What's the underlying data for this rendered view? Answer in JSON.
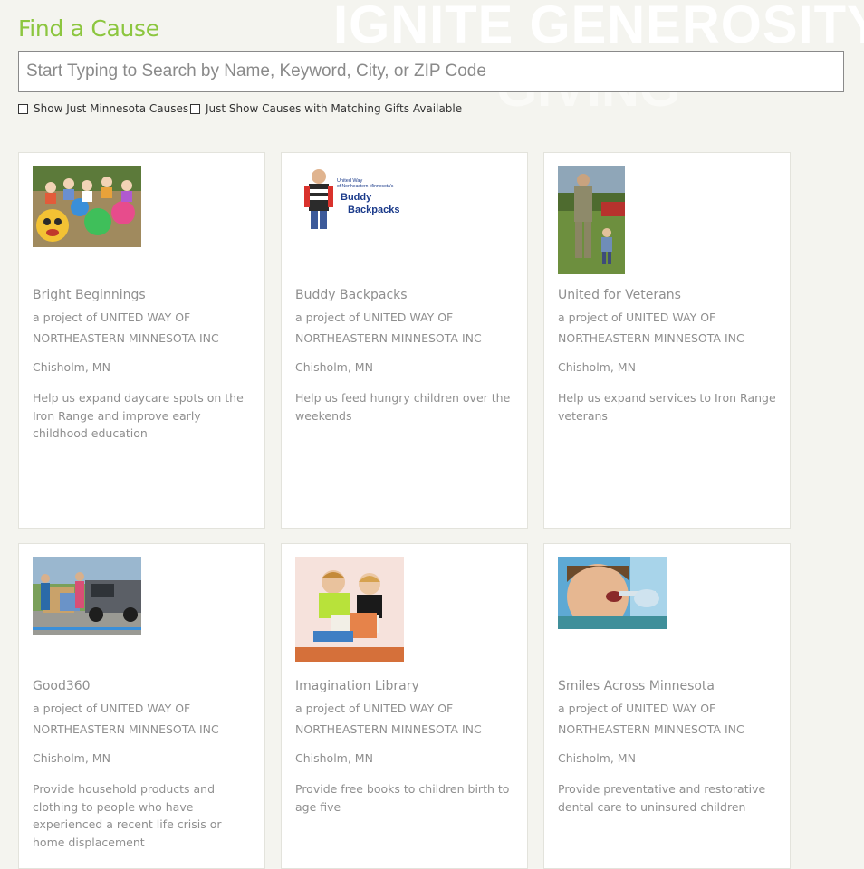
{
  "header": {
    "title": "Find a Cause",
    "banner": "IGNITE GENEROSITY"
  },
  "search": {
    "placeholder": "Start Typing to Search by Name, Keyword, City, or ZIP Code",
    "value": ""
  },
  "filters": {
    "minnesota_label": "Show Just Minnesota Causes",
    "minnesota_checked": false,
    "matching_label": "Just Show Causes with Matching Gifts Available",
    "matching_checked": false
  },
  "thumbnail_labels": {
    "buddy_logo_line1": "United Way",
    "buddy_logo_line2": "of Northeastern Minnesota's",
    "buddy_logo_line3": "Buddy",
    "buddy_logo_line4": "Backpacks"
  },
  "causes": [
    {
      "name": "Bright Beginnings",
      "org": "a project of UNITED WAY OF NORTHEASTERN MINNESOTA INC",
      "location": "Chisholm, MN",
      "description": "Help us expand daycare spots on the Iron Range and improve early childhood education",
      "image": "children-playground-photo"
    },
    {
      "name": "Buddy Backpacks",
      "org": "a project of UNITED WAY OF NORTHEASTERN MINNESOTA INC",
      "location": "Chisholm, MN",
      "description": "Help us feed hungry children over the weekends",
      "image": "buddy-backpacks-logo"
    },
    {
      "name": "United for Veterans",
      "org": "a project of UNITED WAY OF NORTHEASTERN MINNESOTA INC",
      "location": "Chisholm, MN",
      "description": "Help us expand services to Iron Range veterans",
      "image": "soldier-with-child-photo"
    },
    {
      "name": "Good360",
      "org": "a project of UNITED WAY OF NORTHEASTERN MINNESOTA INC",
      "location": "Chisholm, MN",
      "description": "Provide household products and clothing to people who have experienced a recent life crisis or home displacement",
      "image": "truck-loading-photo"
    },
    {
      "name": "Imagination Library",
      "org": "a project of UNITED WAY OF NORTHEASTERN MINNESOTA INC",
      "location": "Chisholm, MN",
      "description": "Provide free books to children birth to age five",
      "image": "children-reading-photo"
    },
    {
      "name": "Smiles Across Minnesota",
      "org": "a project of UNITED WAY OF NORTHEASTERN MINNESOTA INC",
      "location": "Chisholm, MN",
      "description": "Provide preventative and restorative dental care to uninsured children",
      "image": "dental-checkup-photo"
    }
  ],
  "colors": {
    "accent_green": "#8cc63f",
    "page_bg": "#f4f4ef",
    "card_text": "#8f8f8f"
  }
}
